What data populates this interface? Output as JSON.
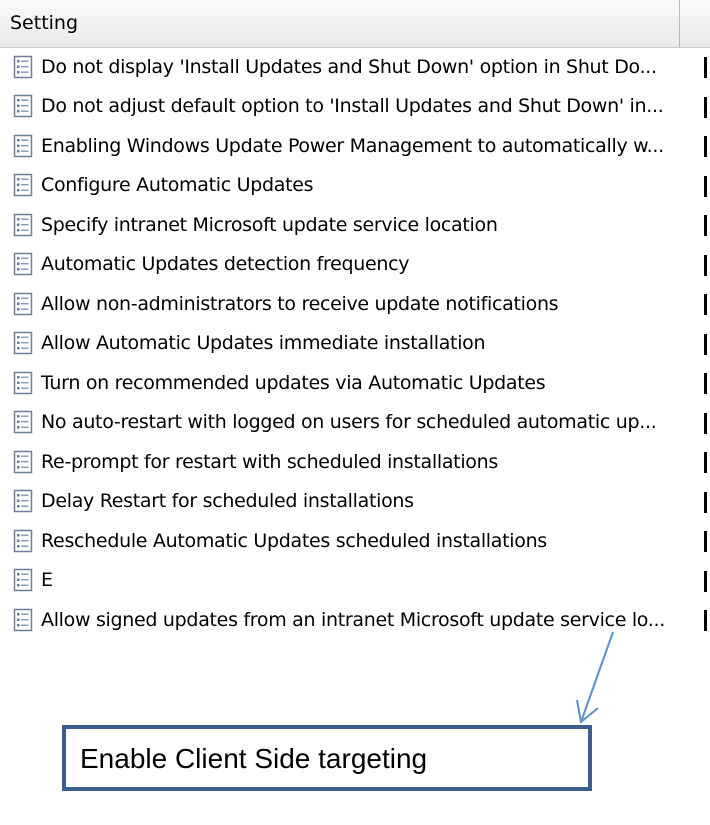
{
  "table": {
    "header_setting": "Setting",
    "header_state": "",
    "rows": [
      {
        "label": "Do not display 'Install Updates and Shut Down' option in Shut Do..."
      },
      {
        "label": "Do not adjust default option to 'Install Updates and Shut Down' in..."
      },
      {
        "label": "Enabling Windows Update Power Management to automatically w..."
      },
      {
        "label": "Configure Automatic Updates"
      },
      {
        "label": "Specify intranet Microsoft update service location"
      },
      {
        "label": "Automatic Updates detection frequency"
      },
      {
        "label": "Allow non-administrators to receive update notifications"
      },
      {
        "label": "Allow Automatic Updates immediate installation"
      },
      {
        "label": "Turn on recommended updates via Automatic Updates"
      },
      {
        "label": "No auto-restart with logged on users for scheduled automatic up..."
      },
      {
        "label": "Re-prompt for restart with scheduled installations"
      },
      {
        "label": "Delay Restart for scheduled installations"
      },
      {
        "label": "Reschedule Automatic Updates scheduled installations"
      },
      {
        "label": "E"
      },
      {
        "label": "Allow signed updates from an intranet Microsoft update service lo..."
      }
    ]
  },
  "callout": {
    "text": "Enable Client Side targeting",
    "border_color": "#3a5f8d",
    "arrow_color": "#5b8fc7"
  },
  "icons": {
    "row_icon": "policy-setting-icon"
  }
}
